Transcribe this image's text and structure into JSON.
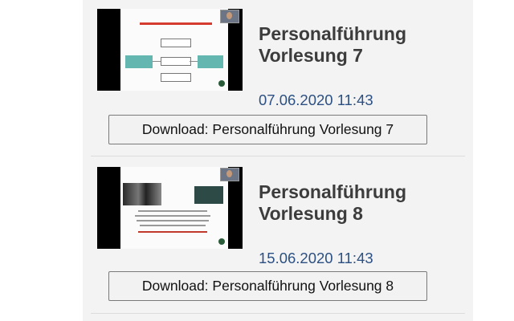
{
  "videos": [
    {
      "title_line1": "Personalführung",
      "title_line2": "Vorlesung 7",
      "date": "07.06.2020 11:43",
      "download_label": "Download: Personalführung Vorlesung 7",
      "accent_color": "#2c5083"
    },
    {
      "title_line1": "Personalführung",
      "title_line2": "Vorlesung 8",
      "date": "15.06.2020 11:43",
      "download_label": "Download: Personalführung Vorlesung 8",
      "accent_color": "#2c5083"
    }
  ]
}
